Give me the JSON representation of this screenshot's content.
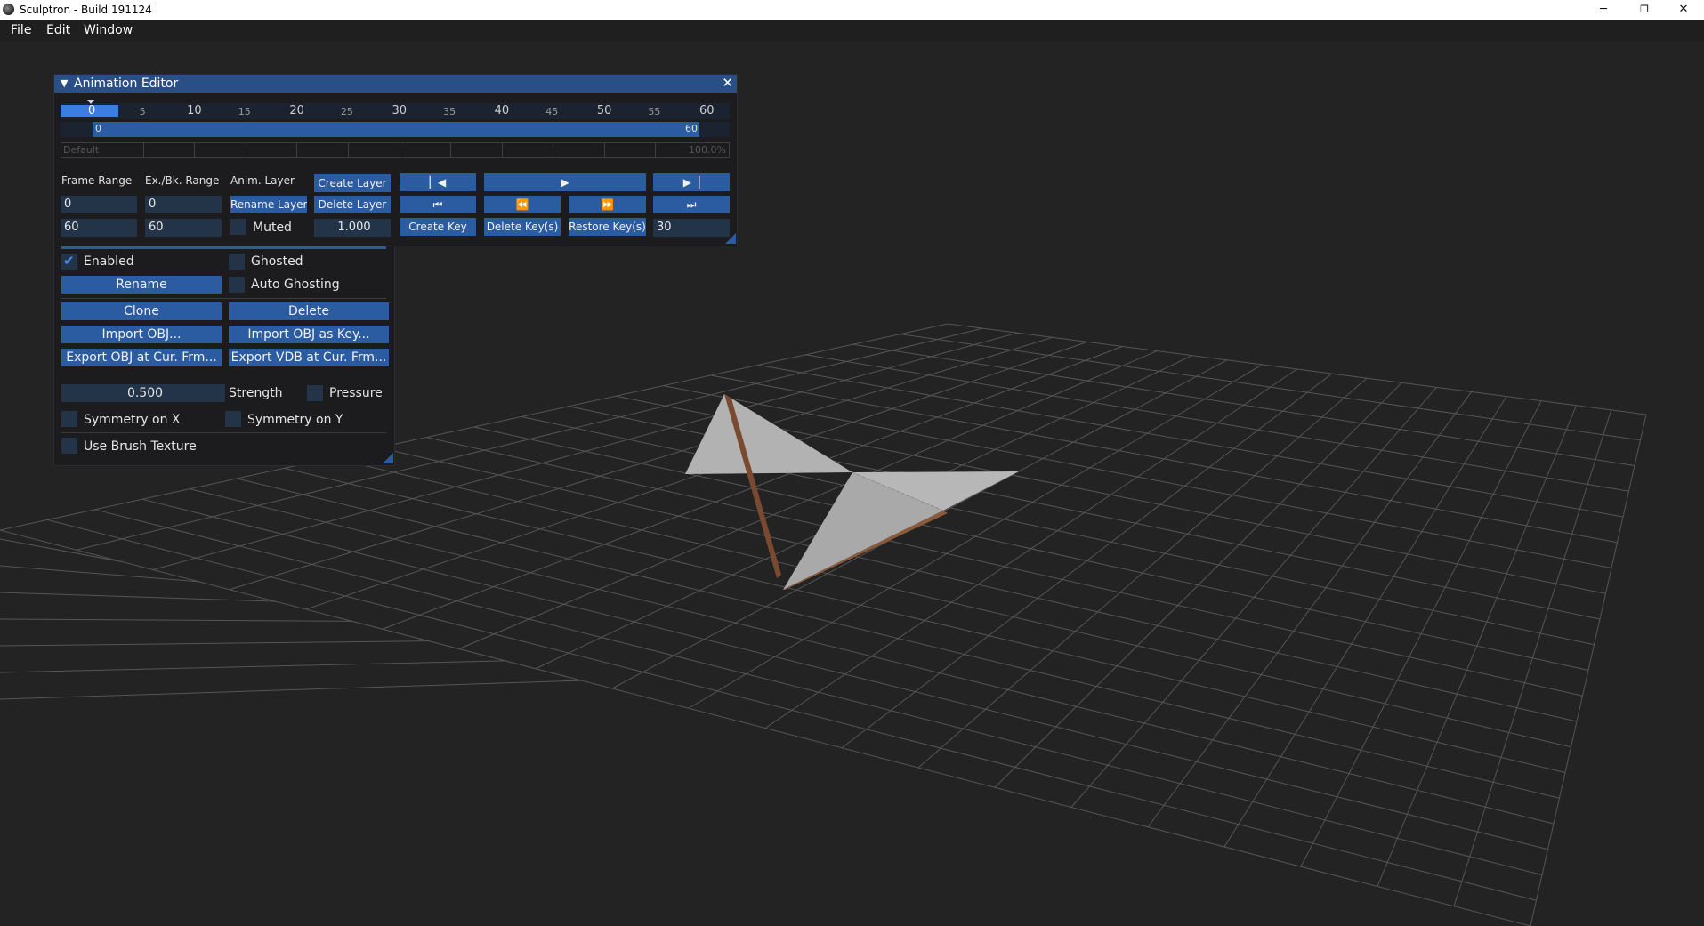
{
  "window": {
    "title": "Sculptron - Build 191124",
    "minimize_glyph": "─",
    "maximize_glyph": "❐",
    "close_glyph": "✕"
  },
  "menu": [
    "File",
    "Edit",
    "Window"
  ],
  "animation_editor": {
    "title": "Animation Editor",
    "close_glyph": "✕",
    "collapse_glyph": "▼",
    "timeline": {
      "current_frame": "0",
      "ticks": [
        "0",
        "5",
        "10",
        "15",
        "20",
        "25",
        "30",
        "35",
        "40",
        "45",
        "50",
        "55",
        "60"
      ],
      "range_start": "0",
      "range_end": "60",
      "layer_name": "Default",
      "layer_weight": "100.0%"
    },
    "labels": {
      "frame_range": "Frame Range",
      "ex_bk_range": "Ex./Bk. Range",
      "anim_layer": "Anim. Layer"
    },
    "frame_range_start": "0",
    "frame_range_end": "60",
    "ex_bk_start": "0",
    "ex_bk_end": "60",
    "buttons": {
      "create_layer": "Create Layer",
      "rename_layer": "Rename Layer",
      "delete_layer": "Delete Layer",
      "create_key": "Create Key",
      "delete_keys": "Delete Key(s)",
      "restore_keys": "Restore Key(s)"
    },
    "muted_label": "Muted",
    "layer_weight_value": "1.000",
    "fps_value": "30",
    "transport_icons": {
      "go_start": "▏◀",
      "play": "▶",
      "go_end": "▶▕",
      "first": "⏮",
      "rewind": "⏪",
      "forward": "⏩",
      "last": "⏭"
    }
  },
  "tool_panel": {
    "enabled_label": "Enabled",
    "ghosted_label": "Ghosted",
    "rename": "Rename",
    "auto_ghosting_label": "Auto Ghosting",
    "clone": "Clone",
    "delete": "Delete",
    "import_obj": "Import OBJ...",
    "import_obj_key": "Import OBJ as Key...",
    "export_obj": "Export OBJ at Cur. Frm...",
    "export_vdb": "Export VDB at Cur. Frm...",
    "strength_value": "0.500",
    "strength_label": "Strength",
    "pressure_label": "Pressure",
    "symmetry_x": "Symmetry on X",
    "symmetry_y": "Symmetry on Y",
    "use_brush_texture": "Use Brush Texture"
  },
  "colors": {
    "accent": "#2b5ba0",
    "title_bar": "#2a4f86",
    "field": "#233448",
    "viewport_bg": "#232323",
    "grid": "#5a5a5a",
    "mesh_light": "#b4b4b4",
    "mesh_dark": "#7a4a30"
  }
}
